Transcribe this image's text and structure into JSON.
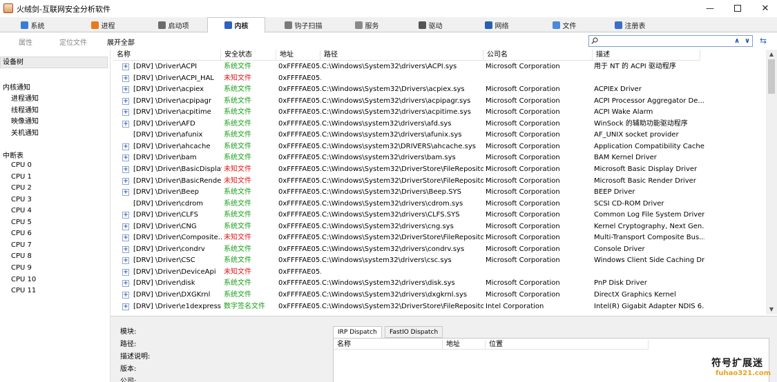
{
  "window": {
    "title": "火绒剑-互联网安全分析软件",
    "min_glyph": "—",
    "close_glyph": "✕"
  },
  "tabs": [
    {
      "label": "系统",
      "icon": "system-icon",
      "color": "#3a7bd5"
    },
    {
      "label": "进程",
      "icon": "windows-icon",
      "color": "#e87a1e"
    },
    {
      "label": "启动项",
      "icon": "startup-icon",
      "color": "#6b6b6b"
    },
    {
      "label": "内核",
      "icon": "kernel-icon",
      "color": "#3060c0",
      "active": true
    },
    {
      "label": "钩子扫描",
      "icon": "hook-icon",
      "color": "#7a7a7a"
    },
    {
      "label": "服务",
      "icon": "service-icon",
      "color": "#8a8a8a"
    },
    {
      "label": "驱动",
      "icon": "driver-icon",
      "color": "#555555"
    },
    {
      "label": "网络",
      "icon": "network-icon",
      "color": "#2a5fb0"
    },
    {
      "label": "文件",
      "icon": "file-icon",
      "color": "#4a8ad8"
    },
    {
      "label": "注册表",
      "icon": "registry-icon",
      "color": "#3a6ec8"
    }
  ],
  "toolbar": {
    "properties": "属性",
    "locate_file": "定位文件",
    "expand_all": "展开全部",
    "search_placeholder": "",
    "up_glyph": "∧",
    "down_glyph": "∨",
    "refresh_glyph": "⇆"
  },
  "left_panel": {
    "header": "设备树",
    "kernel_notify": "内核通知",
    "notify_items": [
      "进程通知",
      "线程通知",
      "映像通知",
      "关机通知"
    ],
    "interrupt_table": "中断表",
    "cpus": [
      "CPU 0",
      "CPU 1",
      "CPU 2",
      "CPU 3",
      "CPU 4",
      "CPU 5",
      "CPU 6",
      "CPU 7",
      "CPU 8",
      "CPU 9",
      "CPU 10",
      "CPU 11"
    ]
  },
  "table": {
    "columns": [
      "名称",
      "安全状态",
      "地址",
      "路径",
      "公司名",
      "描述"
    ],
    "rows": [
      {
        "expand": true,
        "name": "[DRV] \\Driver\\ACPI",
        "status": "系统文件",
        "st": "sys",
        "addr": "0xFFFFAE05...",
        "path": "C:\\Windows\\System32\\drivers\\ACPI.sys",
        "company": "Microsoft Corporation",
        "desc": "用于 NT 的 ACPI 驱动程序"
      },
      {
        "expand": true,
        "name": "[DRV] \\Driver\\ACPI_HAL",
        "status": "未知文件",
        "st": "unk",
        "addr": "0xFFFFAE05...",
        "path": "",
        "company": "",
        "desc": ""
      },
      {
        "expand": true,
        "name": "[DRV] \\Driver\\acpiex",
        "status": "系统文件",
        "st": "sys",
        "addr": "0xFFFFAE05...",
        "path": "C:\\Windows\\System32\\Drivers\\acpiex.sys",
        "company": "Microsoft Corporation",
        "desc": "ACPIEx Driver"
      },
      {
        "expand": true,
        "name": "[DRV] \\Driver\\acpipagr",
        "status": "系统文件",
        "st": "sys",
        "addr": "0xFFFFAE05...",
        "path": "C:\\Windows\\System32\\drivers\\acpipagr.sys",
        "company": "Microsoft Corporation",
        "desc": "ACPI Processor Aggregator De..."
      },
      {
        "expand": true,
        "name": "[DRV] \\Driver\\acpitime",
        "status": "系统文件",
        "st": "sys",
        "addr": "0xFFFFAE05...",
        "path": "C:\\Windows\\System32\\drivers\\acpitime.sys",
        "company": "Microsoft Corporation",
        "desc": "ACPI Wake Alarm"
      },
      {
        "expand": true,
        "name": "[DRV] \\Driver\\AFD",
        "status": "系统文件",
        "st": "sys",
        "addr": "0xFFFFAE05...",
        "path": "C:\\Windows\\system32\\drivers\\afd.sys",
        "company": "Microsoft Corporation",
        "desc": "WinSock 的辅助功能驱动程序"
      },
      {
        "expand": false,
        "name": "[DRV] \\Driver\\afunix",
        "status": "系统文件",
        "st": "sys",
        "addr": "0xFFFFAE05...",
        "path": "C:\\Windows\\system32\\drivers\\afunix.sys",
        "company": "Microsoft Corporation",
        "desc": "AF_UNIX socket provider"
      },
      {
        "expand": true,
        "name": "[DRV] \\Driver\\ahcache",
        "status": "系统文件",
        "st": "sys",
        "addr": "0xFFFFAE05...",
        "path": "C:\\Windows\\system32\\DRIVERS\\ahcache.sys",
        "company": "Microsoft Corporation",
        "desc": "Application Compatibility Cache"
      },
      {
        "expand": true,
        "name": "[DRV] \\Driver\\bam",
        "status": "系统文件",
        "st": "sys",
        "addr": "0xFFFFAE05...",
        "path": "C:\\Windows\\system32\\drivers\\bam.sys",
        "company": "Microsoft Corporation",
        "desc": "BAM Kernel Driver"
      },
      {
        "expand": true,
        "name": "[DRV] \\Driver\\BasicDisplay",
        "status": "未知文件",
        "st": "unk",
        "addr": "0xFFFFAE05...",
        "path": "C:\\Windows\\System32\\DriverStore\\FileRepositor...",
        "company": "Microsoft Corporation",
        "desc": "Microsoft Basic Display Driver"
      },
      {
        "expand": true,
        "name": "[DRV] \\Driver\\BasicRender",
        "status": "未知文件",
        "st": "unk",
        "addr": "0xFFFFAE05...",
        "path": "C:\\Windows\\System32\\DriverStore\\FileRepositor...",
        "company": "Microsoft Corporation",
        "desc": "Microsoft Basic Render Driver"
      },
      {
        "expand": true,
        "name": "[DRV] \\Driver\\Beep",
        "status": "系统文件",
        "st": "sys",
        "addr": "0xFFFFAE05...",
        "path": "C:\\Windows\\System32\\Drivers\\Beep.SYS",
        "company": "Microsoft Corporation",
        "desc": "BEEP Driver"
      },
      {
        "expand": false,
        "name": "[DRV] \\Driver\\cdrom",
        "status": "系统文件",
        "st": "sys",
        "addr": "0xFFFFAE05...",
        "path": "C:\\Windows\\System32\\drivers\\cdrom.sys",
        "company": "Microsoft Corporation",
        "desc": "SCSI CD-ROM Driver"
      },
      {
        "expand": true,
        "name": "[DRV] \\Driver\\CLFS",
        "status": "系统文件",
        "st": "sys",
        "addr": "0xFFFFAE05...",
        "path": "C:\\Windows\\System32\\drivers\\CLFS.SYS",
        "company": "Microsoft Corporation",
        "desc": "Common Log File System Driver"
      },
      {
        "expand": true,
        "name": "[DRV] \\Driver\\CNG",
        "status": "系统文件",
        "st": "sys",
        "addr": "0xFFFFAE05...",
        "path": "C:\\Windows\\System32\\drivers\\cng.sys",
        "company": "Microsoft Corporation",
        "desc": "Kernel Cryptography, Next Gen..."
      },
      {
        "expand": true,
        "name": "[DRV] \\Driver\\Composite...",
        "status": "未知文件",
        "st": "unk",
        "addr": "0xFFFFAE05...",
        "path": "C:\\Windows\\System32\\DriverStore\\FileRepositor...",
        "company": "Microsoft Corporation",
        "desc": "Multi-Transport Composite Bus..."
      },
      {
        "expand": true,
        "name": "[DRV] \\Driver\\condrv",
        "status": "系统文件",
        "st": "sys",
        "addr": "0xFFFFAE05...",
        "path": "C:\\Windows\\System32\\drivers\\condrv.sys",
        "company": "Microsoft Corporation",
        "desc": "Console Driver"
      },
      {
        "expand": true,
        "name": "[DRV] \\Driver\\CSC",
        "status": "系统文件",
        "st": "sys",
        "addr": "0xFFFFAE05...",
        "path": "C:\\Windows\\system32\\drivers\\csc.sys",
        "company": "Microsoft Corporation",
        "desc": "Windows Client Side Caching Dr..."
      },
      {
        "expand": true,
        "name": "[DRV] \\Driver\\DeviceApi",
        "status": "未知文件",
        "st": "unk",
        "addr": "0xFFFFAE05...",
        "path": "",
        "company": "",
        "desc": ""
      },
      {
        "expand": true,
        "name": "[DRV] \\Driver\\disk",
        "status": "系统文件",
        "st": "sys",
        "addr": "0xFFFFAE05...",
        "path": "C:\\Windows\\System32\\drivers\\disk.sys",
        "company": "Microsoft Corporation",
        "desc": "PnP Disk Driver"
      },
      {
        "expand": true,
        "name": "[DRV] \\Driver\\DXGKrnl",
        "status": "系统文件",
        "st": "sys",
        "addr": "0xFFFFAE05...",
        "path": "C:\\Windows\\System32\\drivers\\dxgkrnl.sys",
        "company": "Microsoft Corporation",
        "desc": "DirectX Graphics Kernel"
      },
      {
        "expand": true,
        "name": "[DRV] \\Driver\\e1dexpress",
        "status": "数字签名文件",
        "st": "sig",
        "addr": "0xFFFFAE05...",
        "path": "C:\\Windows\\System32\\DriverStore\\FileRepositor...",
        "company": "Intel Corporation",
        "desc": "Intel(R) Gigabit Adapter NDIS 6...."
      }
    ]
  },
  "detail": {
    "module": "模块:",
    "path": "路径:",
    "description": "描述说明:",
    "version": "版本:",
    "company": "公司:"
  },
  "dispatch": {
    "tab_irp": "IRP Dispatch",
    "tab_fastio": "FastIO Dispatch",
    "columns": [
      "名称",
      "地址",
      "位置"
    ]
  },
  "watermark": {
    "text": "符号扩展迷",
    "url": "fuhao321.com"
  },
  "colors": {
    "system_file": "#18a018",
    "unknown_file": "#e01818",
    "accent": "#3060c0"
  }
}
